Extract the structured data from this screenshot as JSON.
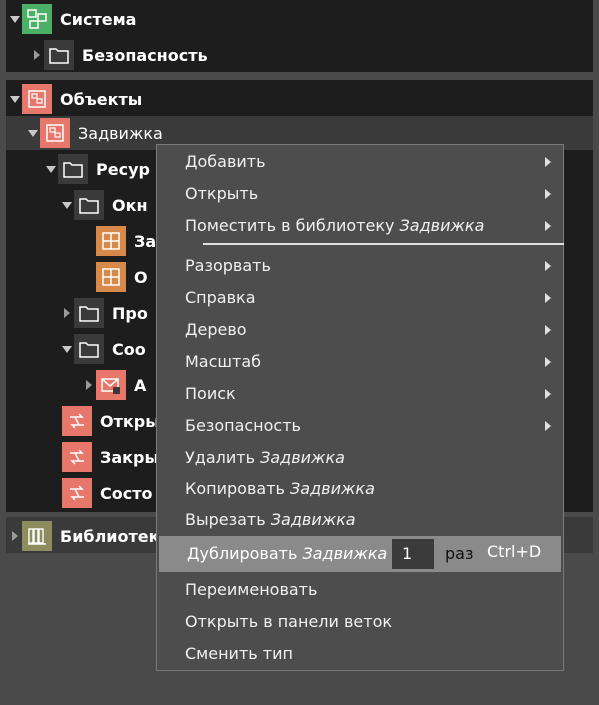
{
  "tree": {
    "system": {
      "label": "Система"
    },
    "security": {
      "label": "Безопасность"
    },
    "objects": {
      "label": "Объекты"
    },
    "valve": {
      "label": "Задвижка"
    },
    "resources": {
      "label": "Ресур"
    },
    "windows": {
      "label": "Окн"
    },
    "item_za": {
      "label": "За"
    },
    "item_o": {
      "label": "О"
    },
    "prop": {
      "label": "Про"
    },
    "messages": {
      "label": "Соо"
    },
    "msg_a": {
      "label": "А"
    },
    "open": {
      "label": "Откры"
    },
    "close": {
      "label": "Закры"
    },
    "state": {
      "label": "Состо"
    },
    "library": {
      "label": "Библиотек"
    }
  },
  "menu": {
    "add": "Добавить",
    "open": "Открыть",
    "to_library_prefix": "Поместить в библиотеку ",
    "to_library_obj": "Задвижка",
    "break": "Разорвать",
    "help": "Справка",
    "tree": "Дерево",
    "scale": "Масштаб",
    "search": "Поиск",
    "security": "Безопасность",
    "delete_prefix": "Удалить ",
    "delete_obj": "Задвижка",
    "copy_prefix": "Копировать ",
    "copy_obj": "Задвижка",
    "cut_prefix": "Вырезать ",
    "cut_obj": "Задвижка",
    "duplicate_prefix": "Дублировать ",
    "duplicate_obj": "Задвижка",
    "duplicate_count": "1",
    "duplicate_unit": "раз",
    "duplicate_shortcut": "Ctrl+D",
    "rename": "Переименовать",
    "open_branch_panel": "Открыть в панели веток",
    "change_type": "Сменить тип"
  }
}
